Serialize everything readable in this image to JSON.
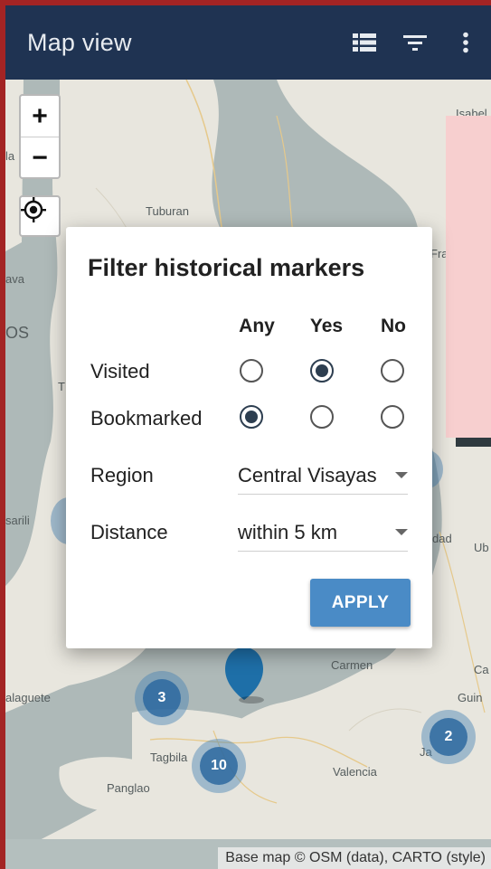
{
  "app_bar": {
    "title": "Map view",
    "bg_color": "#1f3352",
    "actions": [
      {
        "name": "list-view-icon"
      },
      {
        "name": "filter-icon"
      },
      {
        "name": "more-vert-icon"
      }
    ]
  },
  "map": {
    "zoom_in_label": "+",
    "zoom_out_label": "−",
    "locate_icon": "crosshair-icon",
    "labels": {
      "tuburan": "Tuburan",
      "isabel": "Isabel",
      "la": "la",
      "ava": "ava",
      "os": "OS",
      "t": "T",
      "sarili": "sarili",
      "dad": "dad",
      "ub": "Ub",
      "ca": "Ca",
      "guin": "Guin",
      "laguete": "alaguete",
      "carmen": "Carmen",
      "tagbila": "Tagbila",
      "panglao": "Panglao",
      "valencia": "Valencia",
      "ja": "Ja",
      "fra": "Fra"
    },
    "clusters": [
      {
        "count": "3"
      },
      {
        "count": "10"
      },
      {
        "count": "2"
      }
    ],
    "attribution": "Base map © OSM (data), CARTO (style)"
  },
  "dialog": {
    "title": "Filter historical markers",
    "columns": {
      "any": "Any",
      "yes": "Yes",
      "no": "No"
    },
    "rows": {
      "visited": {
        "label": "Visited",
        "selected": "yes"
      },
      "bookmarked": {
        "label": "Bookmarked",
        "selected": "any"
      }
    },
    "region": {
      "label": "Region",
      "value": "Central Visayas"
    },
    "distance": {
      "label": "Distance",
      "value": "within 5 km"
    },
    "apply_label": "APPLY",
    "accent_color": "#4a8bc6"
  }
}
